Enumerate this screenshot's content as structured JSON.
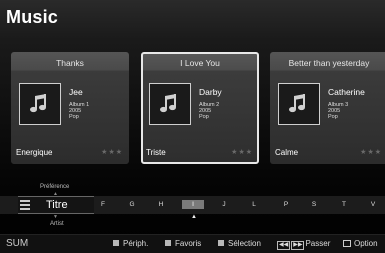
{
  "header": {
    "title": "Music"
  },
  "cards": [
    {
      "title": "Thanks",
      "artist": "Jee",
      "album": "Album 1",
      "year": "2005",
      "genre": "Pop",
      "mood": "Energique",
      "stars": "★★★"
    },
    {
      "title": "I Love You",
      "artist": "Darby",
      "album": "Album 2",
      "year": "2005",
      "genre": "Pop",
      "mood": "Triste",
      "stars": "★★★"
    },
    {
      "title": "Better than yesterday",
      "artist": "Catherine",
      "album": "Album 3",
      "year": "2005",
      "genre": "Pop",
      "mood": "Calme",
      "stars": "★★★"
    }
  ],
  "sort": {
    "above": "Préférence",
    "current": "Titre",
    "below": "Artist"
  },
  "letters": [
    "F",
    "G",
    "H",
    "I",
    "J",
    "L",
    "P",
    "S",
    "T",
    "V"
  ],
  "active_letter_index": 3,
  "footer": {
    "brand": "SUM",
    "device_label": "Périph.",
    "favorites_label": "Favoris",
    "select_label": "Sélection",
    "skip_label": "Passer",
    "options_label": "Option",
    "colors": {
      "red": "#bbbbbb",
      "green": "#bbbbbb",
      "yellow": "#bbbbbb"
    }
  },
  "icons": {
    "album_art": "music-note-icon",
    "sort": "list-icon",
    "options": "tools-icon"
  }
}
